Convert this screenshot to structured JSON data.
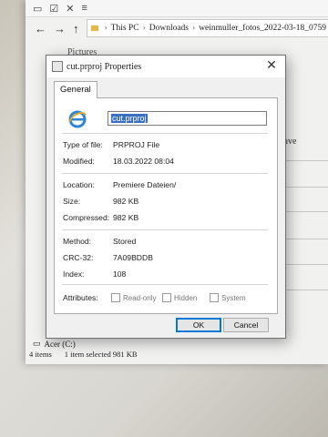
{
  "explorer": {
    "quick_access_icons": [
      "window-icon",
      "checkbox-icon",
      "close-x-icon",
      "rename-icon"
    ],
    "back": "←",
    "forward": "→",
    "up": "↑",
    "breadcrumb": [
      "This PC",
      "Downloads",
      "weinmuller_fotos_2022-03-18_0759"
    ],
    "left_pane_label": "Pictures",
    "right_text": "Save",
    "drive_label": "Acer (C:)",
    "status_items": "4 items",
    "status_selected": "1 item selected  981 KB"
  },
  "dialog": {
    "title": "cut.prproj Properties",
    "close": "✕",
    "tab": "General",
    "filename": "cut.prproj",
    "rows": {
      "type_label": "Type of file:",
      "type_value": "PRPROJ File",
      "modified_label": "Modified:",
      "modified_value": "18.03.2022 08:04",
      "location_label": "Location:",
      "location_value": "Premiere Dateien/",
      "size_label": "Size:",
      "size_value": "982 KB",
      "compressed_label": "Compressed:",
      "compressed_value": "982 KB",
      "method_label": "Method:",
      "method_value": "Stored",
      "crc_label": "CRC-32:",
      "crc_value": "7A09BDDB",
      "index_label": "Index:",
      "index_value": "108",
      "attributes_label": "Attributes:"
    },
    "attributes": [
      "Read-only",
      "Hidden",
      "System"
    ],
    "ok": "OK",
    "cancel": "Cancel"
  }
}
